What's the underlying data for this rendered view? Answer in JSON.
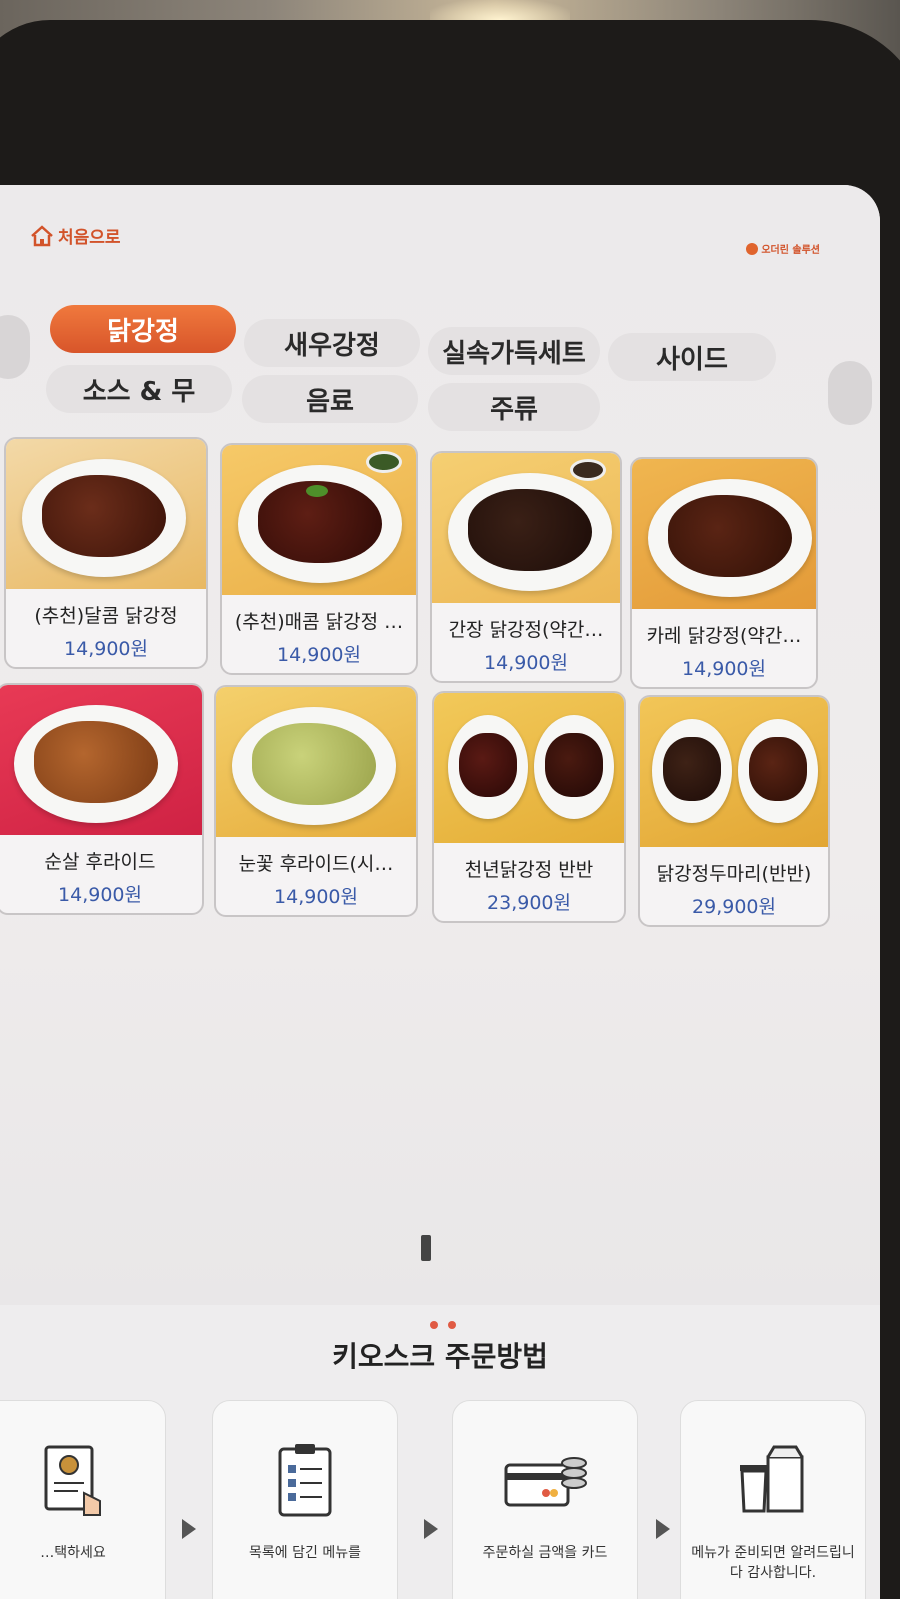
{
  "header": {
    "home_label": "처음으로",
    "brand_label": "오더린 솔루션"
  },
  "tabs": [
    {
      "label": "닭강정",
      "active": true
    },
    {
      "label": "새우강정",
      "active": false
    },
    {
      "label": "실속가득세트",
      "active": false
    },
    {
      "label": "사이드",
      "active": false
    },
    {
      "label": "소스 & 무",
      "active": false
    },
    {
      "label": "음료",
      "active": false
    },
    {
      "label": "주류",
      "active": false
    }
  ],
  "menu": [
    {
      "name": "(추천)달콤 닭강정",
      "price": "14,900원"
    },
    {
      "name": "(추천)매콤 닭강정 …",
      "price": "14,900원"
    },
    {
      "name": "간장 닭강정(약간…",
      "price": "14,900원"
    },
    {
      "name": "카레 닭강정(약간…",
      "price": "14,900원"
    },
    {
      "name": "순살 후라이드",
      "price": "14,900원"
    },
    {
      "name": "눈꽃 후라이드(시…",
      "price": "14,900원"
    },
    {
      "name": "천년닭강정 반반",
      "price": "23,900원"
    },
    {
      "name": "닭강정두마리(반반)",
      "price": "29,900원"
    }
  ],
  "howto": {
    "title": "키오스크 주문방법",
    "steps": [
      {
        "text": "…택하세요",
        "icon": "menu-select-icon"
      },
      {
        "text": "목록에 담긴 메뉴를",
        "icon": "order-list-icon"
      },
      {
        "text": "주문하실 금액을 카드",
        "icon": "card-payment-icon"
      },
      {
        "text": "메뉴가 준비되면 알려드립니다 감사합니다.",
        "icon": "takeout-bag-icon"
      }
    ]
  },
  "colors": {
    "accent": "#d8552a",
    "price": "#3a5aa8",
    "screen_bg": "#ece9ea"
  }
}
